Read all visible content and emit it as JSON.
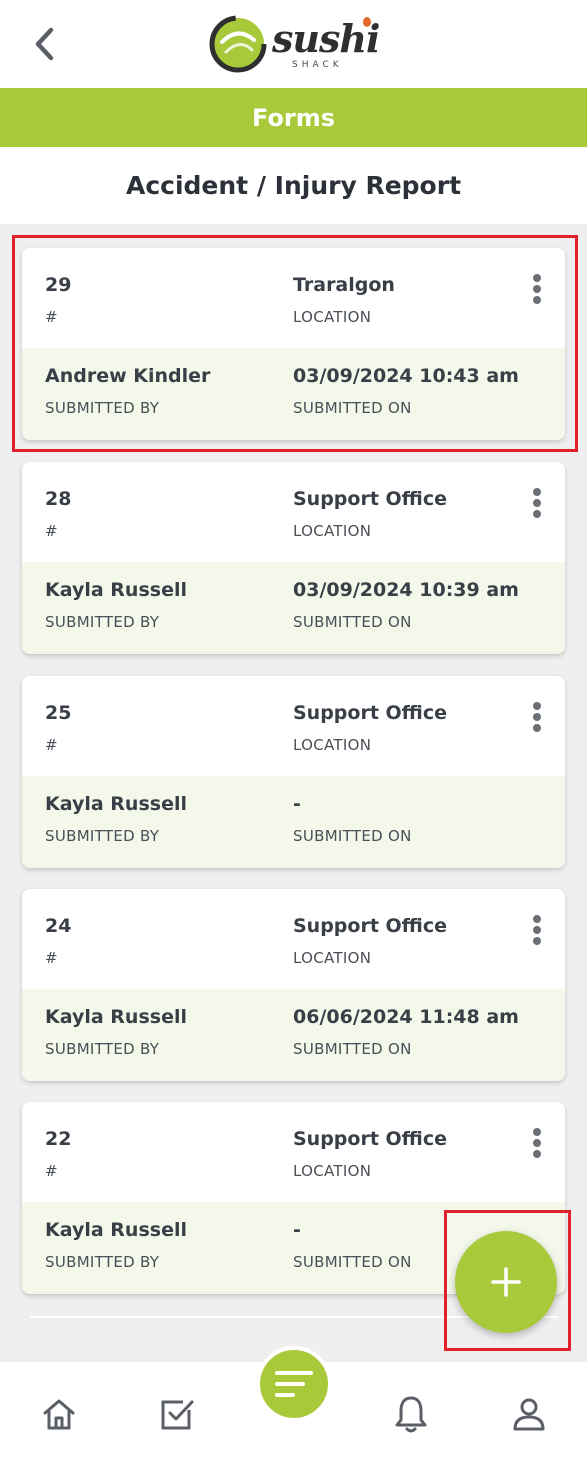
{
  "header": {
    "brand_word": "sushi",
    "brand_sub": "SHACK",
    "section_title": "Forms",
    "page_title": "Accident / Injury Report"
  },
  "labels": {
    "id": "#",
    "location": "LOCATION",
    "submitted_by": "SUBMITTED BY",
    "submitted_on": "SUBMITTED ON"
  },
  "reports": [
    {
      "id": "29",
      "location": "Traralgon",
      "submitted_by": "Andrew Kindler",
      "submitted_on": "03/09/2024 10:43 am"
    },
    {
      "id": "28",
      "location": "Support Office",
      "submitted_by": "Kayla Russell",
      "submitted_on": "03/09/2024 10:39 am"
    },
    {
      "id": "25",
      "location": "Support Office",
      "submitted_by": "Kayla Russell",
      "submitted_on": "-"
    },
    {
      "id": "24",
      "location": "Support Office",
      "submitted_by": "Kayla Russell",
      "submitted_on": "06/06/2024 11:48 am"
    },
    {
      "id": "22",
      "location": "Support Office",
      "submitted_by": "Kayla Russell",
      "submitted_on": "-"
    }
  ],
  "icons": {
    "back": "chevron-left-icon",
    "add": "plus-icon",
    "menu": "more-vertical-icon",
    "nav": [
      "home-icon",
      "checklist-icon",
      "forms-icon",
      "bell-icon",
      "user-icon"
    ]
  },
  "colors": {
    "brand_green": "#a8c93a",
    "highlight_red": "#e0202b",
    "card_bottom": "#f4f8ea"
  }
}
